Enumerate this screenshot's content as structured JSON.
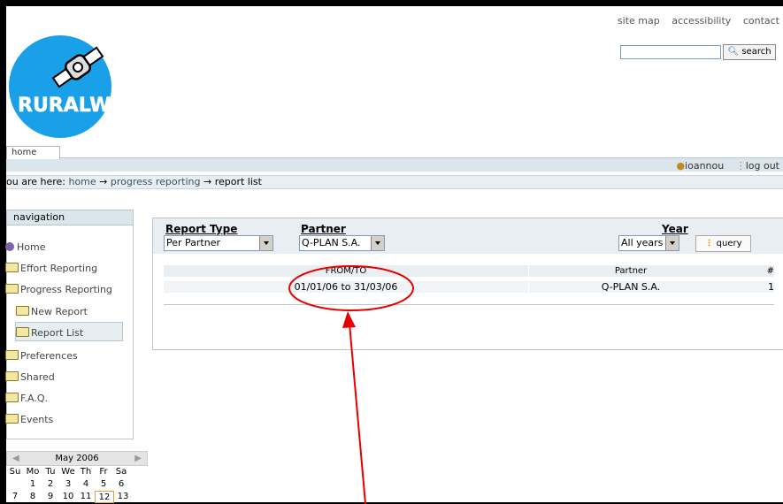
{
  "header": {
    "top_links": [
      "site map",
      "accessibility",
      "contact"
    ],
    "search_button": "search",
    "logo_text": "RURALWINGS",
    "tab": "home"
  },
  "user": {
    "name": "ioannou",
    "logout": "log out"
  },
  "breadcrumb": {
    "prefix": "ou are here:",
    "items": [
      "home",
      "progress reporting",
      "report list"
    ],
    "separator": "→"
  },
  "navigation": {
    "title": "navigation",
    "items": [
      {
        "label": "Home",
        "icon": "globe-icon"
      },
      {
        "label": "Effort Reporting",
        "icon": "folder-icon"
      },
      {
        "label": "Progress Reporting",
        "icon": "folder-icon"
      },
      {
        "label": "New Report",
        "icon": "folder-icon"
      },
      {
        "label": "Report List",
        "icon": "folder-icon"
      },
      {
        "label": "Preferences",
        "icon": "folder-icon"
      },
      {
        "label": "Shared",
        "icon": "folder-icon"
      },
      {
        "label": "F.A.Q.",
        "icon": "folder-icon"
      },
      {
        "label": "Events",
        "icon": "folder-icon"
      }
    ]
  },
  "calendar": {
    "month": "May 2006",
    "weekdays": [
      "Su",
      "Mo",
      "Tu",
      "We",
      "Th",
      "Fr",
      "Sa"
    ],
    "row1": [
      "",
      "1",
      "2",
      "3",
      "4",
      "5",
      "6"
    ],
    "row2": [
      "7",
      "8",
      "9",
      "10",
      "11",
      "12",
      "13"
    ]
  },
  "filters": {
    "report_type_label": "Report Type",
    "report_type_value": "Per Partner",
    "partner_label": "Partner",
    "partner_value": "Q-PLAN S.A.",
    "year_label": "Year",
    "year_value": "All years",
    "query_button": "query"
  },
  "table": {
    "headers": [
      "FROM/TO",
      "Partner",
      "#"
    ],
    "rows": [
      {
        "period": "01/01/06 to 31/03/06",
        "partner": "Q-PLAN S.A.",
        "count": "1"
      }
    ]
  },
  "colors": {
    "annotation": "#e60000",
    "accent": "#e9a12a",
    "logo_blue": "#1aa0e8"
  }
}
